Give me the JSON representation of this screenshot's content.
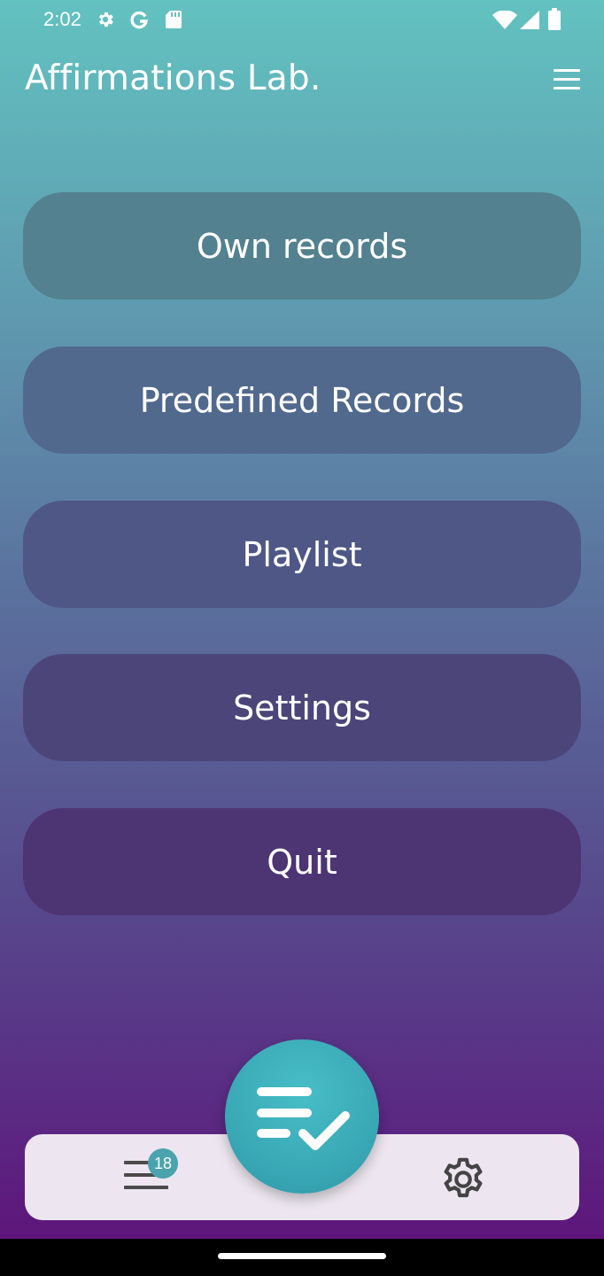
{
  "status_bar": {
    "time": "2:02",
    "icons": [
      "gear-icon",
      "google-g-icon",
      "sd-card-icon",
      "wifi-icon",
      "signal-icon",
      "battery-icon"
    ]
  },
  "header": {
    "title": "Affirmations Lab.",
    "menu_icon": "hamburger-menu-icon"
  },
  "menu": {
    "items": [
      {
        "label": "Own records",
        "color": "#53818f"
      },
      {
        "label": "Predefined Records",
        "color": "#51698d"
      },
      {
        "label": "Playlist",
        "color": "#4e5785"
      },
      {
        "label": "Settings",
        "color": "#4c4579"
      },
      {
        "label": "Quit",
        "color": "#4d3473"
      }
    ]
  },
  "bottom_nav": {
    "left_icon": "list-icon",
    "badge_count": "18",
    "center_icon": "checklist-icon",
    "right_icon": "gear-icon"
  },
  "colors": {
    "accent": "#3aa9b6",
    "bottom_bar_bg": "#ede6f0"
  }
}
